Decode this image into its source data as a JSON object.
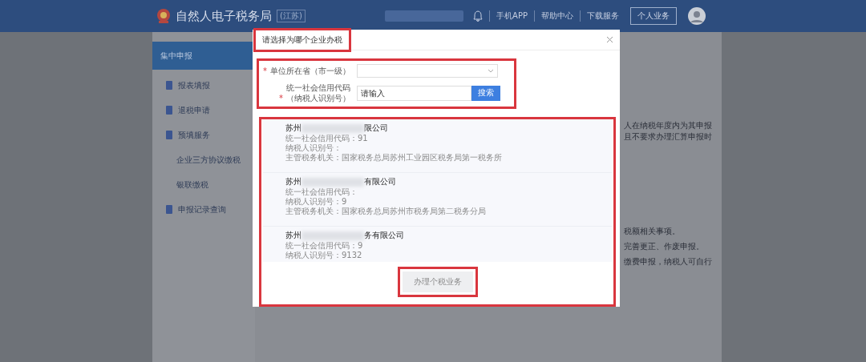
{
  "header": {
    "title": "自然人电子税务局",
    "region": "(江苏)",
    "nav": [
      "手机APP",
      "帮助中心",
      "下载服务"
    ],
    "account_button": "个人业务"
  },
  "sidebar": {
    "items": [
      {
        "label": "集中申报",
        "kind": "section",
        "selected": true
      },
      {
        "label": "报表填报",
        "kind": "icon",
        "selected": false
      },
      {
        "label": "退税申请",
        "kind": "icon",
        "selected": false
      },
      {
        "label": "预填服务",
        "kind": "icon",
        "selected": false
      },
      {
        "label": "企业三方协议缴税",
        "kind": "sub",
        "selected": false
      },
      {
        "label": "银联缴税",
        "kind": "sub",
        "selected": false
      },
      {
        "label": "申报记录查询",
        "kind": "icon",
        "selected": false
      }
    ]
  },
  "background_notes": [
    "人在纳税年度内为其申报",
    "且不要求办理汇算申报时",
    "税额相关事项。",
    "完善更正、作废申报。",
    "缴费申报，纳税人可自行"
  ],
  "dialog": {
    "title": "请选择为哪个企业办税",
    "required_mark": "*",
    "province_label": "单位所在省（市一级）",
    "code_label": [
      "统一社会信用代码",
      "（纳税人识别号）"
    ],
    "code_placeholder": "请输入",
    "search_button": "搜索",
    "companies": [
      {
        "name_start": "苏州",
        "name_end": "限公司",
        "lines": [
          "统一社会信用代码：91",
          "纳税人识别号：",
          "主管税务机关：国家税务总局苏州工业园区税务局第一税务所"
        ]
      },
      {
        "name_start": "苏州",
        "name_end": "有限公司",
        "lines": [
          "统一社会信用代码：",
          "纳税人识别号：9",
          "主管税务机关：国家税务总局苏州市税务局第二税务分局"
        ]
      },
      {
        "name_start": "苏州",
        "name_end": "务有限公司",
        "lines": [
          "统一社会信用代码：9",
          "纳税人识别号：9132"
        ]
      }
    ],
    "confirm_button": "办理个税业务"
  }
}
